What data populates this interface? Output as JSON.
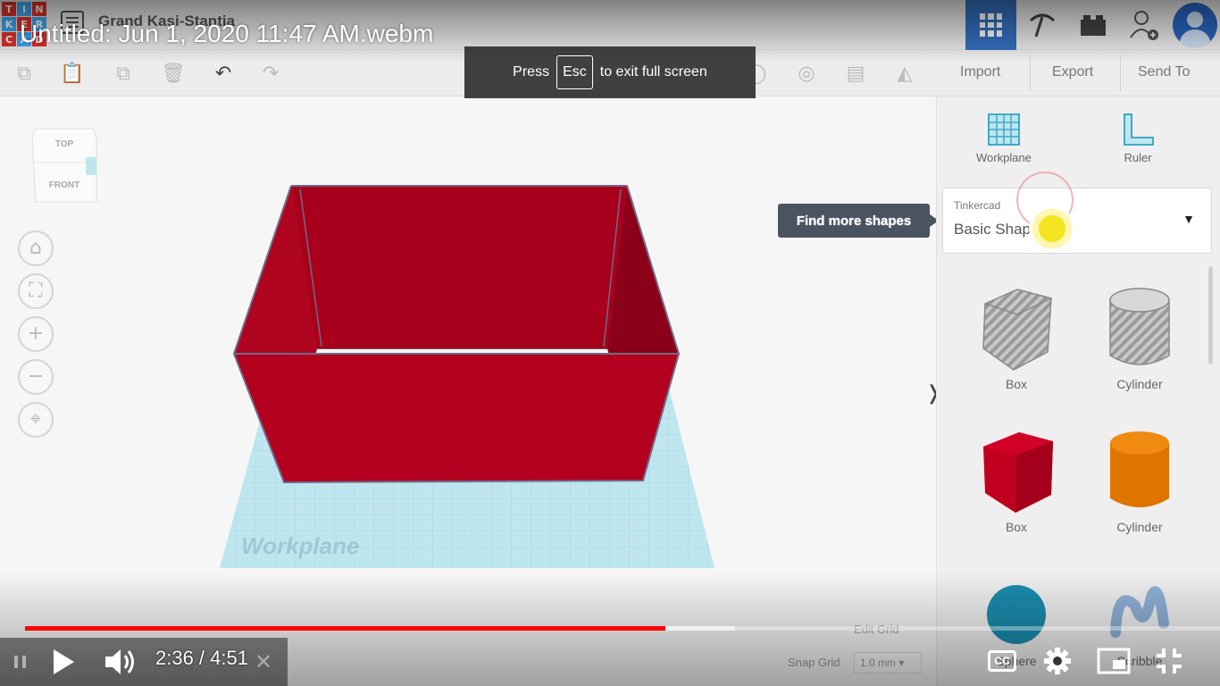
{
  "video": {
    "title": "Untitled: Jun 1, 2020 11:47 AM.webm",
    "fullscreen_notice": {
      "before": "Press",
      "key": "Esc",
      "after": "to exit full screen"
    },
    "time": "2:36 / 4:51",
    "progress_played": 0.536,
    "progress_buffered": 0.594,
    "cc_label": "CC",
    "progress_color": "#ff0000"
  },
  "app": {
    "logo_letters": [
      "T",
      "I",
      "N",
      "K",
      "E",
      "R",
      "C",
      "A",
      "D"
    ],
    "logo_colors": [
      "#e2312b",
      "#3fa9f5",
      "#e2312b",
      "#3fa9f5",
      "#e2312b",
      "#3fa9f5",
      "#e2312b",
      "#3fa9f5",
      "#e2312b"
    ],
    "design_name": "Grand Kasi-Stantia",
    "toolbar": {
      "import": "Import",
      "export": "Export",
      "send_to": "Send To"
    },
    "viewcube": {
      "top": "TOP",
      "front": "FRONT"
    },
    "workplane_label": "Workplane",
    "tooltip": "Find more shapes",
    "panel": {
      "workplane": "Workplane",
      "ruler": "Ruler",
      "category": "Tinkercad",
      "selected": "Basic Shap",
      "shapes": [
        {
          "label": "Box",
          "icon": "box-hole-icon"
        },
        {
          "label": "Cylinder",
          "icon": "cylinder-hole-icon"
        },
        {
          "label": "Box",
          "icon": "box-solid-icon"
        },
        {
          "label": "Cylinder",
          "icon": "cylinder-solid-icon"
        },
        {
          "label": "Sphere",
          "icon": "sphere-icon"
        },
        {
          "label": "Scribble",
          "icon": "scribble-icon"
        }
      ]
    },
    "edit_grid": "Edit Grid",
    "snap_grid": {
      "label": "Snap Grid",
      "value": "1.0 mm"
    },
    "colors": {
      "box_red": "#a8001c",
      "workplane": "#bfe6ee",
      "accent_blue": "#3570c0"
    }
  }
}
